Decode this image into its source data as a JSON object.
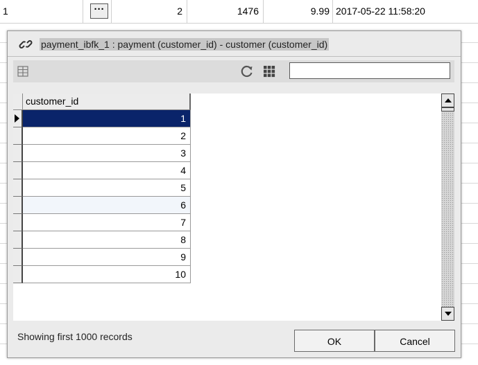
{
  "background": {
    "row": {
      "col1": "1",
      "ellipsis": "···",
      "col3": "2",
      "col4": "1476",
      "col5": "9.99",
      "col6": "2017-05-22 11:58:20"
    }
  },
  "dialog": {
    "title": "payment_ibfk_1 : payment (customer_id) - customer (customer_id)",
    "toolbar": {
      "grid_view_icon": "grid-view-icon",
      "refresh_icon": "refresh-icon",
      "columns_icon": "columns-icon",
      "search_value": "",
      "search_placeholder": ""
    },
    "table": {
      "column_header": "customer_id",
      "selected_index": 0,
      "rows": [
        "1",
        "2",
        "3",
        "4",
        "5",
        "6",
        "7",
        "8",
        "9",
        "10"
      ]
    },
    "status": "Showing first 1000 records",
    "ok_label": "OK",
    "cancel_label": "Cancel"
  },
  "colors": {
    "selection": "#0a246a",
    "dialog_bg": "#ebebeb",
    "title_highlight": "#c7c7c7"
  }
}
